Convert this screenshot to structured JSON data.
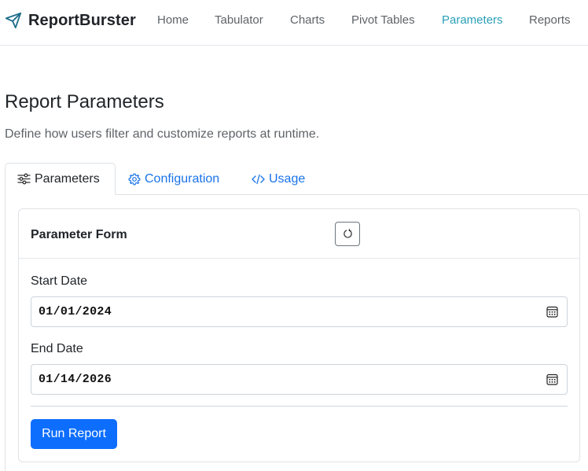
{
  "brand": {
    "name": "ReportBurster"
  },
  "nav": {
    "items": [
      {
        "label": "Home",
        "active": false
      },
      {
        "label": "Tabulator",
        "active": false
      },
      {
        "label": "Charts",
        "active": false
      },
      {
        "label": "Pivot Tables",
        "active": false
      },
      {
        "label": "Parameters",
        "active": true
      },
      {
        "label": "Reports",
        "active": false
      }
    ]
  },
  "header": {
    "title": "Report Parameters",
    "subtitle": "Define how users filter and customize reports at runtime."
  },
  "tabs": [
    {
      "label": "Parameters",
      "icon": "sliders-icon",
      "active": true
    },
    {
      "label": "Configuration",
      "icon": "gear-icon",
      "active": false
    },
    {
      "label": "Usage",
      "icon": "code-icon",
      "active": false
    }
  ],
  "form": {
    "title": "Parameter Form",
    "refresh_icon": "refresh-icon",
    "fields": [
      {
        "label": "Start Date",
        "value": "01/01/2024",
        "icon": "calendar-icon"
      },
      {
        "label": "End Date",
        "value": "01/14/2026",
        "icon": "calendar-icon"
      }
    ],
    "submit_label": "Run Report"
  },
  "colors": {
    "active_nav": "#2a9fb8",
    "link": "#1a73e8",
    "primary_button": "#0d6efd"
  }
}
